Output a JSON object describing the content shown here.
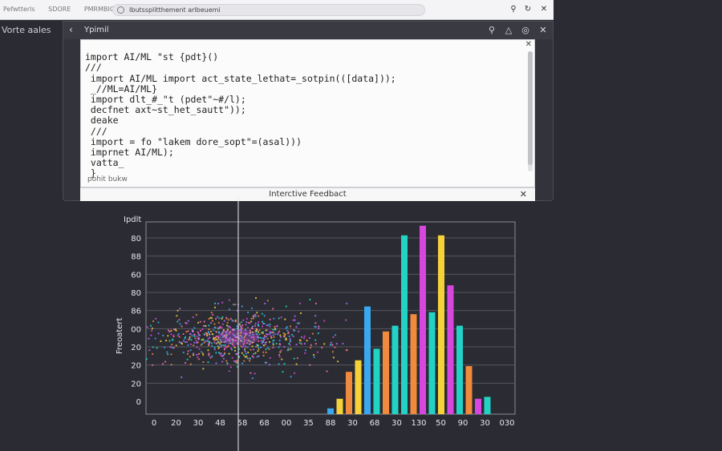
{
  "browser": {
    "tabs": [
      "Pefwtterls",
      "SDORE",
      "PMRMBIOBI"
    ],
    "url": "Ibutssplitthement arlbeuemi"
  },
  "side_label": "Vorte aales",
  "app": {
    "title": "Ypimil",
    "editor_lines": [
      "import AI/ML \"st {pdt}()",
      "///",
      " import AI/ML import act_state_lethat=_sotpin(([data]));",
      " _//ML=AI/ML}",
      " import dlt_#_\"t (pdet\"~#/l);",
      " decfnet axt~st_het_sautt\"));",
      " deake",
      " ///",
      " import = fo \"lakem dore_sopt\"=(asal)))",
      " imprnet AI/ML);",
      " vatta_",
      " }"
    ],
    "status_text": "pohit bukw",
    "feedback_label": "Interctive Feedbact"
  },
  "colors": {
    "accent": "#3b82f6",
    "cyan": "#22d3c5",
    "blue": "#3aa8f0",
    "orange": "#f08a3c",
    "yellow": "#f6d23a",
    "magenta": "#d846e0"
  },
  "chart_data": {
    "type": "bar",
    "title": "",
    "xlabel": "",
    "ylabel": "Freoatert",
    "y_unit_label": "Ipdlt",
    "y_ticks": [
      "0",
      "20",
      "20",
      "20",
      "00",
      "86",
      "80",
      "60",
      "88",
      "80"
    ],
    "x_ticks": [
      "0",
      "20",
      "30",
      "48",
      "58",
      "68",
      "00",
      "35",
      "88",
      "30",
      "68",
      "30",
      "130",
      "50",
      "90",
      "30",
      "030"
    ],
    "ylim": [
      0,
      100
    ],
    "bars": [
      {
        "x": 60,
        "value": 3,
        "color": "blue"
      },
      {
        "x": 63,
        "value": 8,
        "color": "yellow"
      },
      {
        "x": 66,
        "value": 22,
        "color": "orange"
      },
      {
        "x": 69,
        "value": 28,
        "color": "yellow"
      },
      {
        "x": 72,
        "value": 56,
        "color": "blue"
      },
      {
        "x": 75,
        "value": 34,
        "color": "cyan"
      },
      {
        "x": 78,
        "value": 43,
        "color": "orange"
      },
      {
        "x": 81,
        "value": 46,
        "color": "cyan"
      },
      {
        "x": 84,
        "value": 93,
        "color": "cyan"
      },
      {
        "x": 87,
        "value": 52,
        "color": "orange"
      },
      {
        "x": 90,
        "value": 98,
        "color": "magenta"
      },
      {
        "x": 93,
        "value": 53,
        "color": "cyan"
      },
      {
        "x": 96,
        "value": 93,
        "color": "yellow"
      },
      {
        "x": 99,
        "value": 67,
        "color": "magenta"
      },
      {
        "x": 102,
        "value": 46,
        "color": "cyan"
      },
      {
        "x": 105,
        "value": 25,
        "color": "orange"
      },
      {
        "x": 108,
        "value": 8,
        "color": "magenta"
      },
      {
        "x": 111,
        "value": 9,
        "color": "cyan"
      }
    ],
    "scatter": {
      "center_x": 30,
      "center_y": 40,
      "count": 700,
      "spread_x": 14,
      "spread_y": 6
    },
    "cursor_x": 30,
    "grid": true
  }
}
